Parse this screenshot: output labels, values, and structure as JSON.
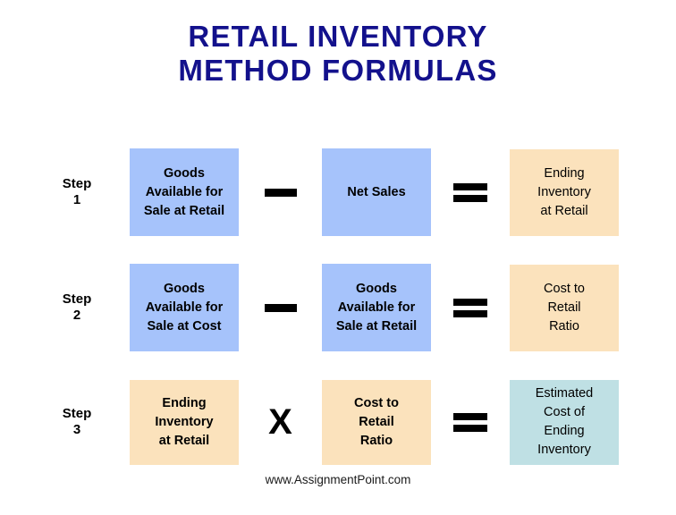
{
  "title": {
    "line1": "RETAIL INVENTORY",
    "line2": "METHOD FORMULAS",
    "color": "#13118C"
  },
  "colors": {
    "blue_box": "#A6C3FB",
    "peach_box": "#FBE2BC",
    "teal_box": "#BFE0E4",
    "operator": "#000000",
    "title": "#13118C"
  },
  "rows": [
    {
      "step_word": "Step",
      "step_number": "1",
      "operand1": {
        "fill": "blue",
        "line1": "Goods",
        "line2": "Available for",
        "line3": "Sale at Retail"
      },
      "operator": "minus",
      "operator_symbol": "—",
      "operand2": {
        "fill": "blue",
        "line1": "Net Sales"
      },
      "equals_symbol": "=",
      "result": {
        "fill": "peach",
        "line1": "Ending",
        "line2": "Inventory",
        "line3": "at Retail"
      }
    },
    {
      "step_word": "Step",
      "step_number": "2",
      "operand1": {
        "fill": "blue",
        "line1": "Goods",
        "line2": "Available for",
        "line3": "Sale at Cost"
      },
      "operator": "minus",
      "operator_symbol": "—",
      "operand2": {
        "fill": "blue",
        "line1": "Goods",
        "line2": "Available for",
        "line3": "Sale at Retail"
      },
      "equals_symbol": "=",
      "result": {
        "fill": "peach",
        "line1": "Cost to",
        "line2": "Retail",
        "line3": "Ratio"
      }
    },
    {
      "step_word": "Step",
      "step_number": "3",
      "operand1": {
        "fill": "peach",
        "line1": "Ending",
        "line2": "Inventory",
        "line3": "at Retail"
      },
      "operator": "times",
      "operator_symbol": "X",
      "operand2": {
        "fill": "peach",
        "line1": "Cost to",
        "line2": "Retail",
        "line3": "Ratio"
      },
      "equals_symbol": "=",
      "result": {
        "fill": "teal",
        "line1": "Estimated",
        "line2": "Cost of",
        "line3": "Ending",
        "line4": "Inventory"
      }
    }
  ],
  "footer": {
    "text": "www.AssignmentPoint.com"
  }
}
